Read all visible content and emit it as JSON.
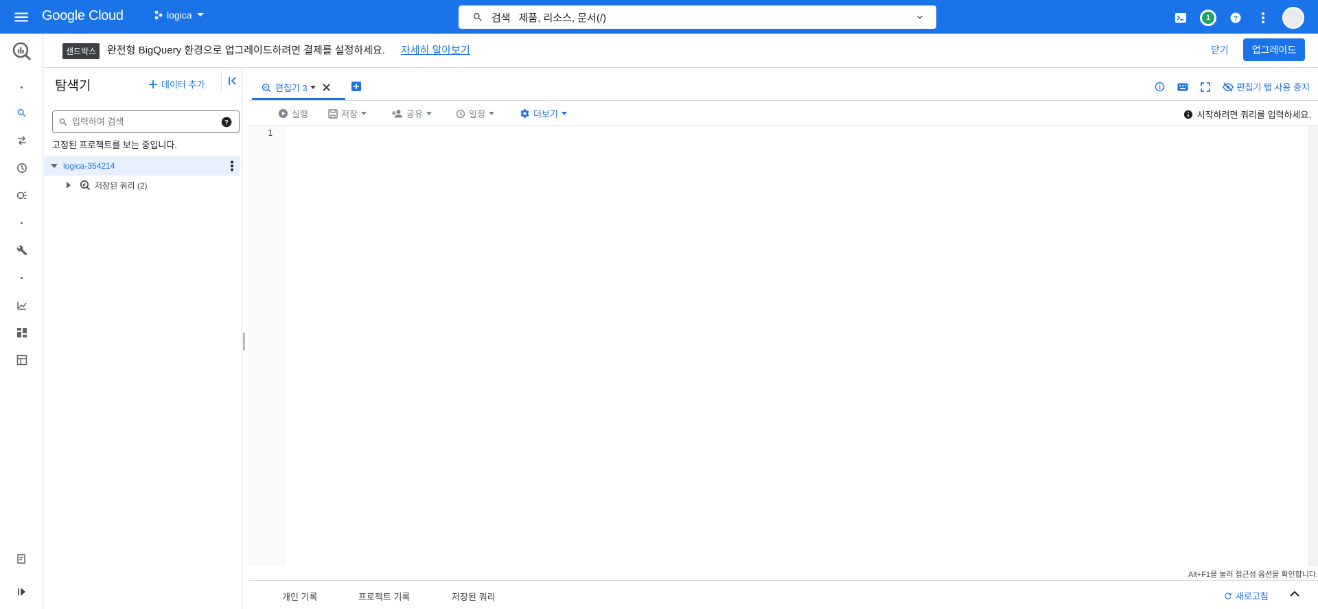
{
  "header": {
    "brand": "Google Cloud",
    "project_name": "logica",
    "search_label": "검색",
    "search_placeholder": "제품, 리소스, 문서(/)",
    "notification_count": "1"
  },
  "banner": {
    "badge": "샌드박스",
    "message": "완전형 BigQuery 환경으로 업그레이드하려면 결제를 설정하세요.",
    "link": "자세히 알아보기",
    "close_label": "닫기",
    "upgrade_label": "업그레이드"
  },
  "explorer": {
    "title": "탐색기",
    "add_data_label": "데이터 추가",
    "search_placeholder": "입력하여 검색",
    "pinned_note": "고정된 프로젝트를 보는 중입니다.",
    "project_id": "logica-354214",
    "saved_queries_label": "저장된 쿼리 (2)"
  },
  "editor": {
    "tab_label": "편집기 3",
    "disable_tabs_label": "편집기 탭 사용 중지",
    "toolbar": {
      "run": "실행",
      "save": "저장",
      "share": "공유",
      "schedule": "일정",
      "more": "더보기"
    },
    "hint": "시작하려면 쿼리를 입력하세요.",
    "line_number": "1",
    "a11y_hint": "Alt+F1을 눌러 접근성 옵션을 확인합니다."
  },
  "bottom": {
    "personal_history": "개인 기록",
    "project_history": "프로젝트 기록",
    "saved_queries": "저장된 쿼리",
    "refresh": "새로고침"
  },
  "colors": {
    "brand_blue": "#1a73e8",
    "badge_dark": "#3c4043",
    "notification_green": "#1aa260"
  }
}
